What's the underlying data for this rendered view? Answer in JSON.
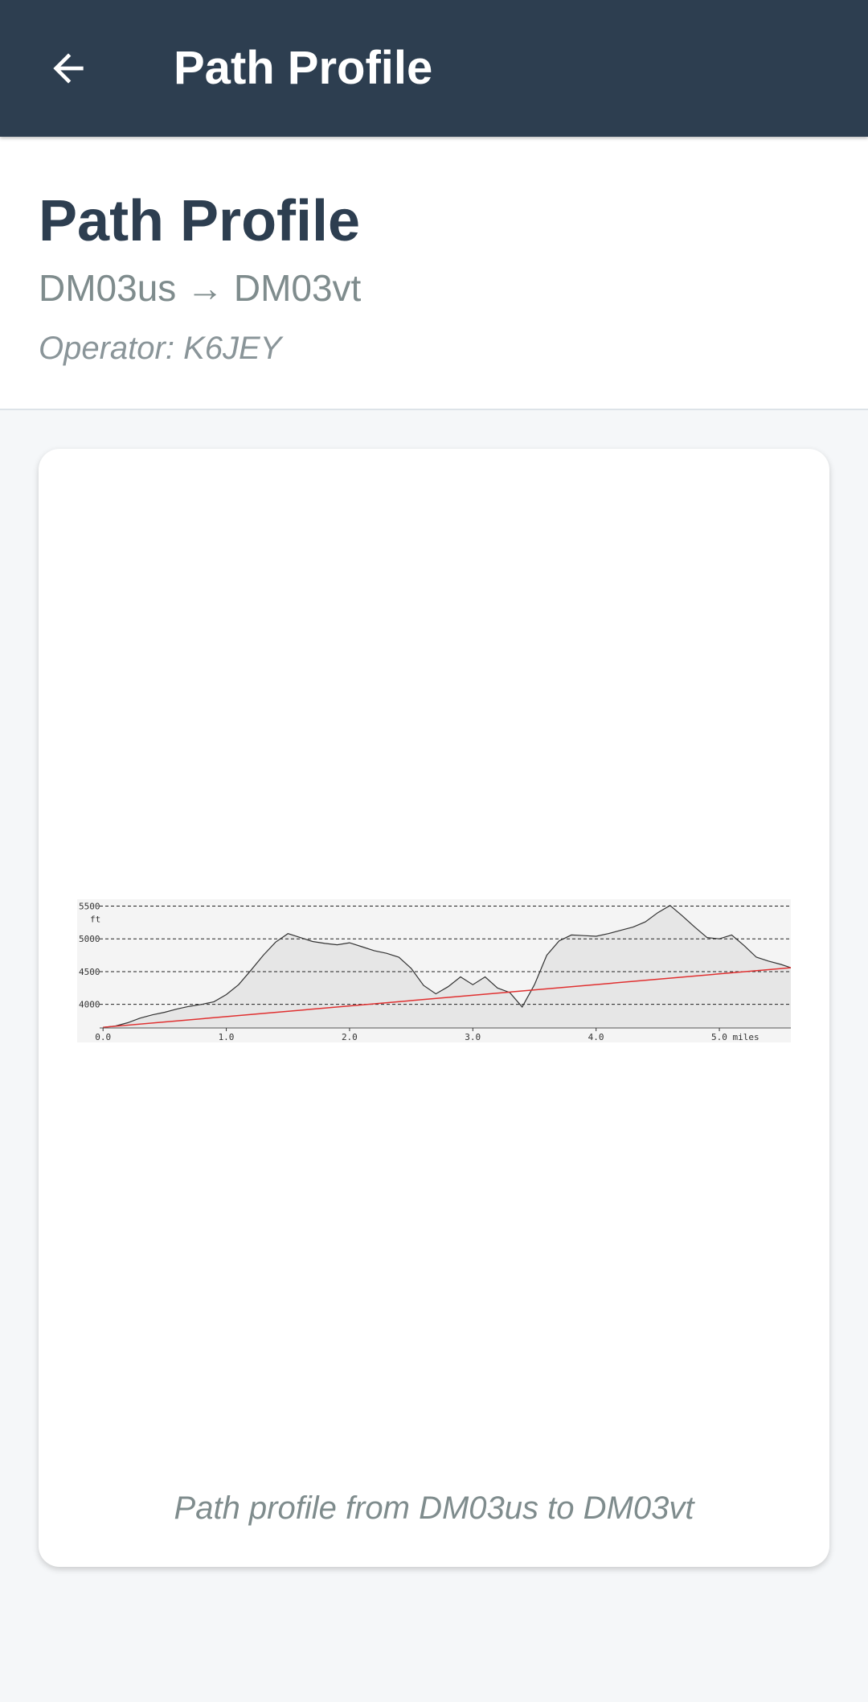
{
  "appbar": {
    "title": "Path Profile",
    "back_icon": "arrow-left-icon"
  },
  "header": {
    "title": "Path Profile",
    "route": "DM03us → DM03vt",
    "operator": "Operator: K6JEY"
  },
  "card": {
    "caption": "Path profile from DM03us to DM03vt"
  },
  "colors": {
    "appbar": "#2d3e50",
    "terrain_fill": "#e6e6e6",
    "terrain_line": "#333333",
    "los_line": "#e03030"
  },
  "chart_data": {
    "type": "area",
    "title": "",
    "xlabel": "miles",
    "ylabel": "ft",
    "xlim": [
      -0.21,
      5.58
    ],
    "ylim": [
      3640,
      5580
    ],
    "y_ticks": [
      4000,
      4500,
      5000,
      5500
    ],
    "y_tick_labels": [
      "4000",
      "4500",
      "5000",
      "5500"
    ],
    "x_ticks": [
      0,
      1,
      2,
      3,
      4,
      5
    ],
    "x_tick_labels": [
      "0.0",
      "1.0",
      "2.0",
      "3.0",
      "4.0",
      "5.0 miles"
    ],
    "grid": "dashed horizontal",
    "series": [
      {
        "kind": "terrain",
        "x": [
          0.0,
          0.1,
          0.2,
          0.3,
          0.4,
          0.5,
          0.6,
          0.7,
          0.8,
          0.9,
          1.0,
          1.1,
          1.2,
          1.3,
          1.4,
          1.5,
          1.6,
          1.7,
          1.8,
          1.9,
          2.0,
          2.1,
          2.2,
          2.3,
          2.4,
          2.5,
          2.6,
          2.7,
          2.8,
          2.9,
          3.0,
          3.1,
          3.2,
          3.3,
          3.4,
          3.5,
          3.6,
          3.7,
          3.8,
          3.9,
          4.0,
          4.1,
          4.2,
          4.3,
          4.4,
          4.5,
          4.6,
          4.7,
          4.8,
          4.9,
          5.0,
          5.1,
          5.2,
          5.3,
          5.4,
          5.5,
          5.58
        ],
        "y": [
          3650,
          3670,
          3720,
          3790,
          3840,
          3880,
          3930,
          3970,
          4000,
          4040,
          4150,
          4300,
          4520,
          4750,
          4950,
          5080,
          5020,
          4960,
          4930,
          4910,
          4940,
          4880,
          4820,
          4780,
          4720,
          4550,
          4290,
          4160,
          4270,
          4420,
          4300,
          4420,
          4250,
          4180,
          3960,
          4300,
          4750,
          4970,
          5060,
          5050,
          5040,
          5080,
          5130,
          5180,
          5260,
          5400,
          5510,
          5350,
          5180,
          5020,
          5000,
          5060,
          4900,
          4720,
          4660,
          4610,
          4560
        ]
      },
      {
        "kind": "line_of_sight",
        "x": [
          0.0,
          5.58
        ],
        "y": [
          3650,
          4560
        ]
      }
    ]
  }
}
